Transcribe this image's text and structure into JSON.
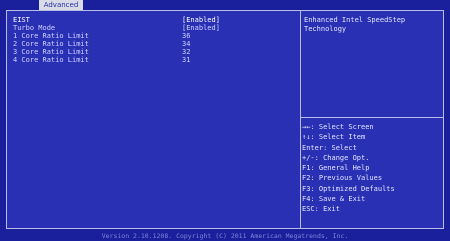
{
  "tabs": [
    {
      "label": "Advanced"
    }
  ],
  "settings": [
    {
      "label": "EIST",
      "value": "[Enabled]"
    },
    {
      "label": "Turbo Mode",
      "value": "[Enabled]"
    },
    {
      "label": "1 Core Ratio Limit",
      "value": "36"
    },
    {
      "label": "2 Core Ratio Limit",
      "value": "34"
    },
    {
      "label": "3 Core Ratio Limit",
      "value": "32"
    },
    {
      "label": "4 Core Ratio Limit",
      "value": "31"
    }
  ],
  "help": {
    "line1": "Enhanced Intel SpeedStep",
    "line2": "Technology"
  },
  "keys": [
    "→←: Select Screen",
    "↑↓: Select Item",
    "Enter: Select",
    "+/-: Change Opt.",
    "F1: General Help",
    "F2: Previous Values",
    "F3: Optimized Defaults",
    "F4: Save & Exit",
    "ESC: Exit"
  ],
  "footer": "Version 2.10.1208. Copyright (C) 2011 American Megatrends, Inc.",
  "colors": {
    "background": "#1a1f9c",
    "panel": "#2a30b3",
    "tab": "#d9dbe6",
    "text": "#cdd3ff",
    "highlight": "#ffffff"
  }
}
